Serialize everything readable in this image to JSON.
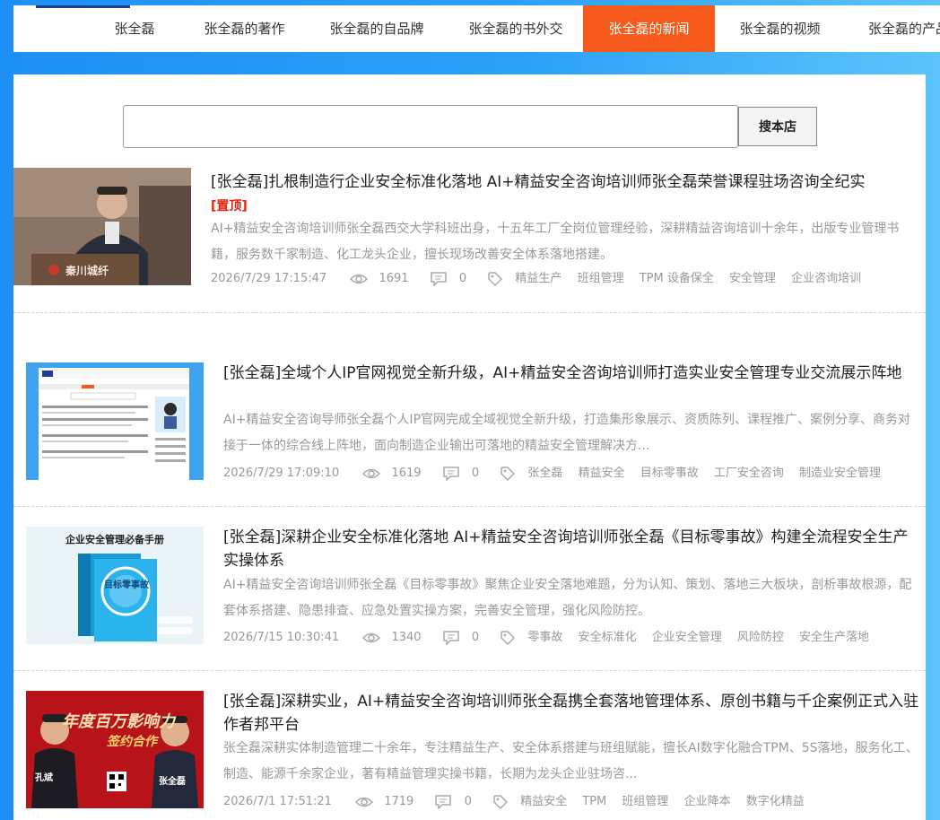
{
  "nav": {
    "items": [
      {
        "label": "张全磊"
      },
      {
        "label": "张全磊的著作"
      },
      {
        "label": "张全磊的自品牌"
      },
      {
        "label": "张全磊的书外交"
      },
      {
        "label": "张全磊的新闻"
      },
      {
        "label": "张全磊的视频"
      },
      {
        "label": "张全磊的产品"
      }
    ],
    "active_index": 4
  },
  "search": {
    "value": "",
    "button_label": "搜本店"
  },
  "articles": [
    {
      "title": "[张全磊]扎根制造行企业安全标准化落地 AI+精益安全咨询培训师张全磊荣誉课程驻场咨询全纪实",
      "pinned_label": "[置顶]",
      "summary": "AI+精益安全咨询培训师张全磊西交大学科班出身，十五年工厂全岗位管理经验，深耕精益咨询培训十余年，出版专业管理书籍，服务数千家制造、化工龙头企业，擅长现场改善安全体系落地搭建。",
      "date": "2026/7/29 17:15:47",
      "views": "1691",
      "comments": "0",
      "tags": [
        "精益生产",
        "班组管理",
        "TPM 设备保全",
        "安全管理",
        "企业咨询培训"
      ],
      "thumb_text": "秦川城纤"
    },
    {
      "title": "[张全磊]全域个人IP官网视觉全新升级，AI+精益安全咨询培训师打造实业安全管理专业交流展示阵地",
      "summary": "AI+精益安全咨询导师张全磊个人IP官网完成全域视觉全新升级，打造集形象展示、资质陈列、课程推广、案例分享、商务对接于一体的综合线上阵地，面向制造企业输出可落地的精益安全管理解决方...",
      "date": "2026/7/29 17:09:10",
      "views": "1619",
      "comments": "0",
      "tags": [
        "张全磊",
        "精益安全",
        "目标零事故",
        "工厂安全咨询",
        "制造业安全管理"
      ]
    },
    {
      "title": "[张全磊]深耕企业安全标准化落地 AI+精益安全咨询培训师张全磊《目标零事故》构建全流程安全生产实操体系",
      "summary": "AI+精益安全咨询培训师张全磊《目标零事故》聚焦企业安全落地难题，分为认知、策划、落地三大板块，剖析事故根源，配套体系搭建、隐患排查、应急处置实操方案，完善安全管理，强化风险防控。",
      "date": "2026/7/15 10:30:41",
      "views": "1340",
      "comments": "0",
      "tags": [
        "零事故",
        "安全标准化",
        "企业安全管理",
        "风险防控",
        "安全生产落地"
      ],
      "thumb_header": "企业安全管理必备手册",
      "thumb_book": "目标零事故"
    },
    {
      "title": "[张全磊]深耕实业，AI+精益安全咨询培训师张全磊携全套落地管理体系、原创书籍与千企案例正式入驻作者邦平台",
      "summary": "张全磊深耕实体制造管理二十余年，专注精益生产、安全体系搭建与班组赋能，擅长AI数字化融合TPM、5S落地，服务化工、制造、能源千余家企业，著有精益管理实操书籍，长期为龙头企业驻场咨...",
      "date": "2026/7/1 17:51:21",
      "views": "1719",
      "comments": "0",
      "tags": [
        "精益安全",
        "TPM",
        "班组管理",
        "企业降本",
        "数字化精益"
      ],
      "thumb_banner": "年度百万影响力",
      "thumb_sub": "签约合作",
      "thumb_left_name": "孔斌",
      "thumb_right_name": "张全磊"
    }
  ],
  "colors": {
    "accent": "#f55a1a",
    "page_bg": "#1e90f5",
    "pinned": "#e0230d"
  }
}
